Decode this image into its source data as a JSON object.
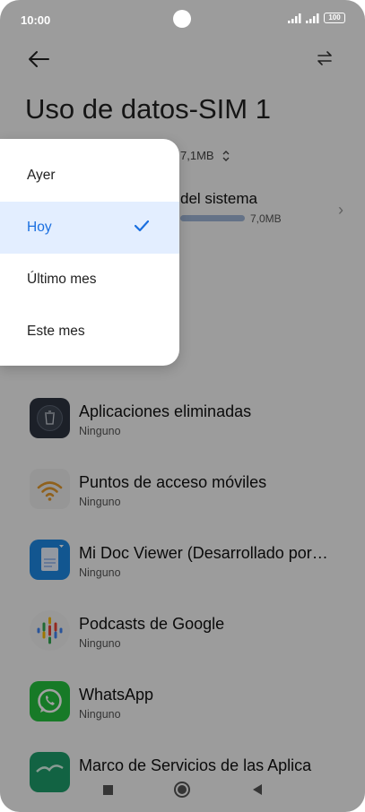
{
  "status_bar": {
    "time": "10:00",
    "battery": "100"
  },
  "header": {
    "back_icon": "arrow-left-icon",
    "swap_icon": "swap-arrows-icon"
  },
  "page": {
    "title": "Uso de datos-SIM 1",
    "period_value": "7,1MB",
    "system_row": {
      "title": "Servicios del sistema",
      "visible_title": "del sistema",
      "usage": "7,0MB"
    }
  },
  "apps": [
    {
      "name": "Aplicaciones eliminadas",
      "sub": "Ninguno",
      "icon": "trash-icon"
    },
    {
      "name": "Puntos de acceso móviles",
      "sub": "Ninguno",
      "icon": "wifi-hotspot-icon"
    },
    {
      "name": "Mi Doc Viewer (Desarrollado por…",
      "sub": "Ninguno",
      "icon": "document-viewer-icon"
    },
    {
      "name": "Podcasts de Google",
      "sub": "Ninguno",
      "icon": "google-podcasts-icon"
    },
    {
      "name": "WhatsApp",
      "sub": "Ninguno",
      "icon": "whatsapp-icon"
    },
    {
      "name": "Marco de Servicios de las Aplica",
      "sub": "",
      "icon": "app-framework-icon"
    }
  ],
  "menu": {
    "items": [
      {
        "label": "Ayer",
        "selected": false
      },
      {
        "label": "Hoy",
        "selected": true
      },
      {
        "label": "Último mes",
        "selected": false
      },
      {
        "label": "Este mes",
        "selected": false
      }
    ],
    "accent_color": "#1a6fe0"
  }
}
